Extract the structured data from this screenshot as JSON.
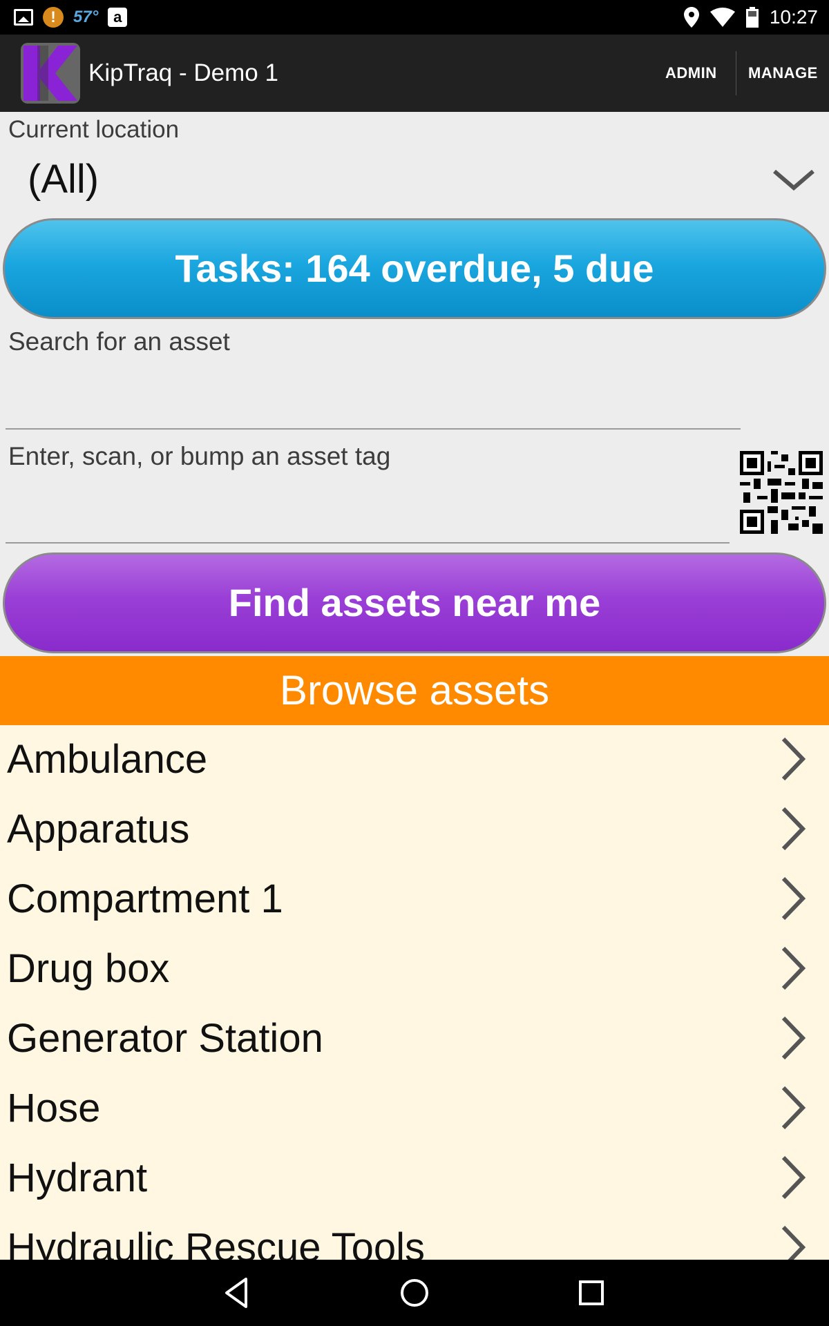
{
  "status_bar": {
    "temperature": "57°",
    "amazon_glyph": "a",
    "alert_glyph": "!",
    "time": "10:27",
    "icons": [
      "gallery-icon",
      "alert-icon",
      "amazon-icon",
      "location-icon",
      "wifi-icon",
      "battery-icon"
    ]
  },
  "app_bar": {
    "logo_letter": "K",
    "title": "KipTraq - Demo 1",
    "actions": [
      "ADMIN",
      "MANAGE"
    ]
  },
  "location": {
    "label": "Current location",
    "selected": "(All)"
  },
  "tasks_button": {
    "label": "Tasks: 164 overdue, 5 due",
    "color": "#1aa6df"
  },
  "search": {
    "label": "Search for an asset",
    "value": ""
  },
  "asset_tag": {
    "label": "Enter, scan, or bump an asset tag",
    "value": ""
  },
  "find_button": {
    "label": "Find assets near me",
    "color": "#9a3fd6"
  },
  "browse": {
    "header": "Browse assets",
    "header_color": "#ff8a00",
    "items": [
      "Ambulance",
      "Apparatus",
      "Compartment 1",
      "Drug box",
      "Generator Station",
      "Hose",
      "Hydrant",
      "Hydraulic Rescue Tools"
    ]
  },
  "nav_bar": {
    "icons": [
      "back-icon",
      "home-icon",
      "recent-apps-icon"
    ]
  }
}
